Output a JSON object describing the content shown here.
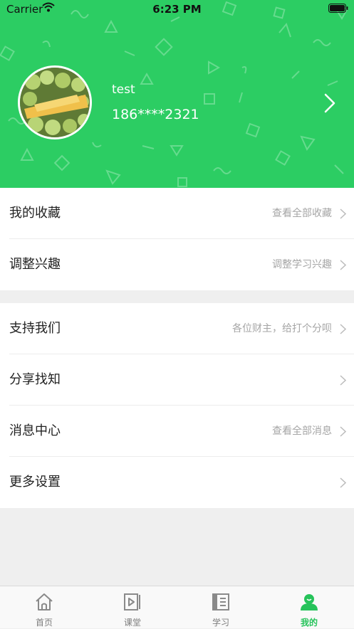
{
  "status_bar": {
    "carrier": "Carrier",
    "time": "6:23 PM"
  },
  "profile": {
    "name": "test",
    "phone": "186****2321"
  },
  "menu_group_1": [
    {
      "title": "我的收藏",
      "hint": "查看全部收藏"
    },
    {
      "title": "调整兴趣",
      "hint": "调整学习兴趣"
    }
  ],
  "menu_group_2": [
    {
      "title": "支持我们",
      "hint": "各位财主，给打个分呗"
    },
    {
      "title": "分享找知",
      "hint": ""
    },
    {
      "title": "消息中心",
      "hint": "查看全部消息"
    },
    {
      "title": "更多设置",
      "hint": ""
    }
  ],
  "tab_bar": [
    {
      "label": "首页",
      "icon": "home-icon"
    },
    {
      "label": "课堂",
      "icon": "video-icon"
    },
    {
      "label": "学习",
      "icon": "notebook-icon"
    },
    {
      "label": "我的",
      "icon": "profile-icon",
      "active": true
    }
  ],
  "colors": {
    "brand_green": "#2ccd63",
    "active_tab": "#26c35a",
    "background": "#efefef"
  }
}
